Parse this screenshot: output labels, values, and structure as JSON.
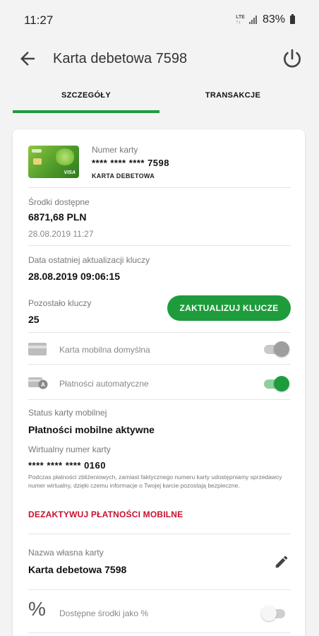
{
  "status": {
    "time": "11:27",
    "network_top": "LTE",
    "network_bottom": "↑↓",
    "battery": "83%"
  },
  "header": {
    "title": "Karta debetowa 7598"
  },
  "tabs": [
    {
      "label": "SZCZEGÓŁY",
      "active": true
    },
    {
      "label": "TRANSAKCJE",
      "active": false
    }
  ],
  "card": {
    "number_label": "Numer karty",
    "masked_number": "**** **** ****",
    "last_digits": "7598",
    "type": "KARTA DEBETOWA",
    "thumb_brand": "VISA"
  },
  "funds": {
    "label": "Środki dostępne",
    "amount": "6871,68 PLN",
    "timestamp": "28.08.2019 11:27"
  },
  "keys_update": {
    "label": "Data ostatniej aktualizacji kluczy",
    "value": "28.08.2019 09:06:15"
  },
  "keys_left": {
    "label": "Pozostało kluczy",
    "value": "25",
    "button": "ZAKTUALIZUJ KLUCZE"
  },
  "settings": [
    {
      "label": "Karta mobilna domyślna",
      "icon": "credit-card-icon",
      "state": "on-disabled"
    },
    {
      "label": "Płatności automatyczne",
      "icon": "auto-payment-card-icon",
      "state": "on"
    }
  ],
  "mobile_status": {
    "label": "Status karty mobilnej",
    "value": "Płatności mobilne aktywne"
  },
  "virtual_number": {
    "label": "Wirtualny numer karty",
    "masked": "**** **** ****",
    "last_digits": "0160",
    "note": "Podczas płatności zbliżeniowych, zamiast faktycznego numeru karty udostępniamy sprzedawcy numer wirtualny, dzięki czemu informacje o Twojej karcie pozostają bezpieczne."
  },
  "deactivate": {
    "label": "DEZAKTYWUJ PŁATNOŚCI MOBILNE",
    "color": "#c8102e"
  },
  "custom_name": {
    "label": "Nazwa własna karty",
    "value": "Karta debetowa 7598"
  },
  "percent_toggle": {
    "icon_glyph": "%",
    "label": "Dostępne środki jako %",
    "state": "off"
  },
  "colors": {
    "accent": "#1e9c3c",
    "danger": "#c8102e"
  }
}
